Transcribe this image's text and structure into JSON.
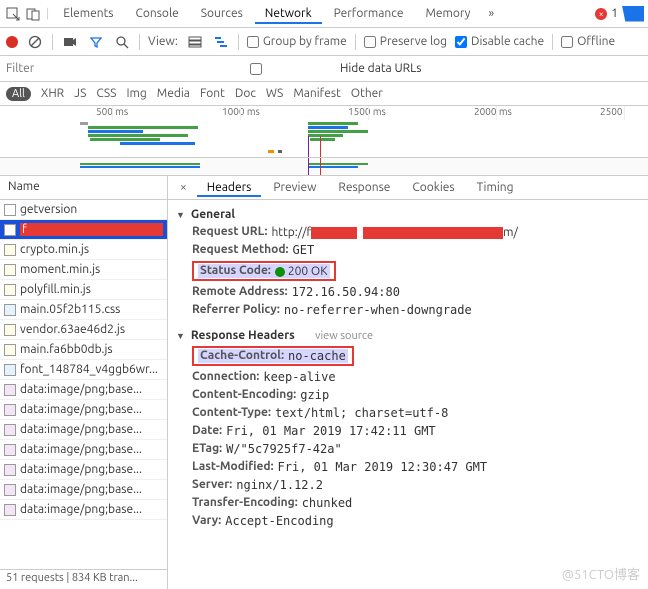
{
  "topTabs": {
    "elements": "Elements",
    "console": "Console",
    "sources": "Sources",
    "network": "Network",
    "performance": "Performance",
    "memory": "Memory",
    "errCount": "1"
  },
  "toolbar": {
    "view": "View:",
    "groupByFrame": "Group by frame",
    "preserveLog": "Preserve log",
    "disableCache": "Disable cache",
    "offline": "Offline"
  },
  "filter": {
    "placeholder": "Filter",
    "hideData": "Hide data URLs"
  },
  "types": {
    "all": "All",
    "xhr": "XHR",
    "js": "JS",
    "css": "CSS",
    "img": "Img",
    "media": "Media",
    "font": "Font",
    "doc": "Doc",
    "ws": "WS",
    "manifest": "Manifest",
    "other": "Other"
  },
  "ticks": [
    "500 ms",
    "1000 ms",
    "1500 ms",
    "2000 ms",
    "2500"
  ],
  "list": {
    "header": "Name",
    "status": "51 requests   |   834 KB tran...",
    "items": [
      {
        "n": "getversion",
        "t": "doc"
      },
      {
        "n": "f",
        "t": "sel"
      },
      {
        "n": "crypto.min.js",
        "t": "js"
      },
      {
        "n": "moment.min.js",
        "t": "js"
      },
      {
        "n": "polyfill.min.js",
        "t": "js"
      },
      {
        "n": "main.05f2b115.css",
        "t": "css"
      },
      {
        "n": "vendor.63ae46d2.js",
        "t": "js"
      },
      {
        "n": "main.fa6bb0db.js",
        "t": "js"
      },
      {
        "n": "font_148784_v4ggb6wr...",
        "t": "css"
      },
      {
        "n": "data:image/png;base...",
        "t": "img"
      },
      {
        "n": "data:image/png;base...",
        "t": "img"
      },
      {
        "n": "data:image/png;base...",
        "t": "img"
      },
      {
        "n": "data:image/png;base...",
        "t": "img"
      },
      {
        "n": "data:image/png;base...",
        "t": "img"
      },
      {
        "n": "data:image/png;base...",
        "t": "img"
      },
      {
        "n": "data:image/png;base...",
        "t": "img"
      }
    ]
  },
  "dtabs": {
    "headers": "Headers",
    "preview": "Preview",
    "response": "Response",
    "cookies": "Cookies",
    "timing": "Timing"
  },
  "general": {
    "title": "General",
    "url_k": "Request URL:",
    "url_v1": "http://f",
    "url_v2": "m/",
    "method_k": "Request Method:",
    "method_v": "GET",
    "status_k": "Status Code:",
    "status_v": "200 OK",
    "remote_k": "Remote Address:",
    "remote_v": "172.16.50.94:80",
    "ref_k": "Referrer Policy:",
    "ref_v": "no-referrer-when-downgrade"
  },
  "resp": {
    "title": "Response Headers",
    "vs": "view source",
    "cc_k": "Cache-Control:",
    "cc_v": "no-cache",
    "conn_k": "Connection:",
    "conn_v": "keep-alive",
    "ce_k": "Content-Encoding:",
    "ce_v": "gzip",
    "ct_k": "Content-Type:",
    "ct_v": "text/html; charset=utf-8",
    "date_k": "Date:",
    "date_v": "Fri, 01 Mar 2019 17:42:11 GMT",
    "etag_k": "ETag:",
    "etag_v": "W/\"5c7925f7-42a\"",
    "lm_k": "Last-Modified:",
    "lm_v": "Fri, 01 Mar 2019 12:30:47 GMT",
    "srv_k": "Server:",
    "srv_v": "nginx/1.12.2",
    "te_k": "Transfer-Encoding:",
    "te_v": "chunked",
    "vary_k": "Vary:",
    "vary_v": "Accept-Encoding"
  },
  "watermark": "@51CTO博客"
}
